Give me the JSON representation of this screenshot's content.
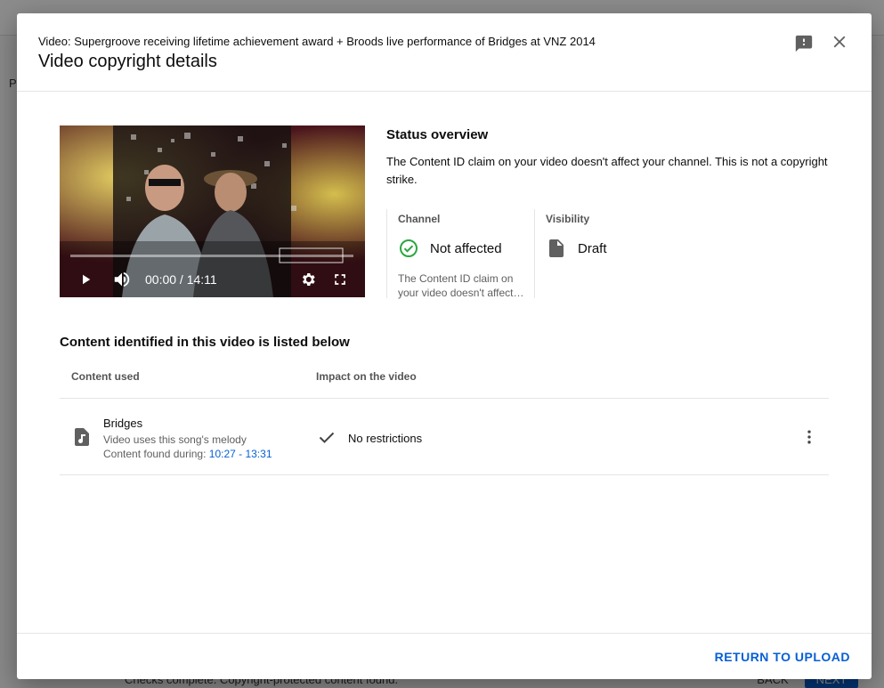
{
  "dialog": {
    "video_line": "Video: Supergroove receiving lifetime achievement award + Broods live performance of Bridges at VNZ 2014",
    "title": "Video copyright details",
    "feedback_icon": "feedback-icon",
    "close_icon": "close-icon"
  },
  "player": {
    "time": "00:00 / 14:11",
    "progress": 0,
    "controls": [
      "play-icon",
      "volume-icon",
      "settings-icon",
      "fullscreen-icon"
    ]
  },
  "status": {
    "heading": "Status overview",
    "description": "The Content ID claim on your video doesn't affect your channel. This is not a copyright strike.",
    "channel": {
      "label": "Channel",
      "value": "Not affected",
      "note_line1": "The Content ID claim on",
      "note_line2": "your video doesn't affect your channel."
    },
    "visibility": {
      "label": "Visibility",
      "value": "Draft"
    }
  },
  "content": {
    "heading": "Content identified in this video is listed below",
    "columns": [
      "Content used",
      "Impact on the video"
    ],
    "rows": [
      {
        "title": "Bridges",
        "subtitle": "Video uses this song's melody",
        "found_label": "Content found during:",
        "found_range": "10:27 - 13:31",
        "impact": "No restrictions"
      }
    ]
  },
  "footer": {
    "return_label": "Return to upload"
  },
  "background": {
    "side_letter": "P",
    "status_text": "Checks complete. Copyright-protected content found.",
    "back_label": "BACK",
    "next_label": "NEXT"
  },
  "colors": {
    "accent": "#065fd4",
    "success": "#2ba640",
    "text": "#0d0d0d",
    "secondary": "#606060"
  }
}
